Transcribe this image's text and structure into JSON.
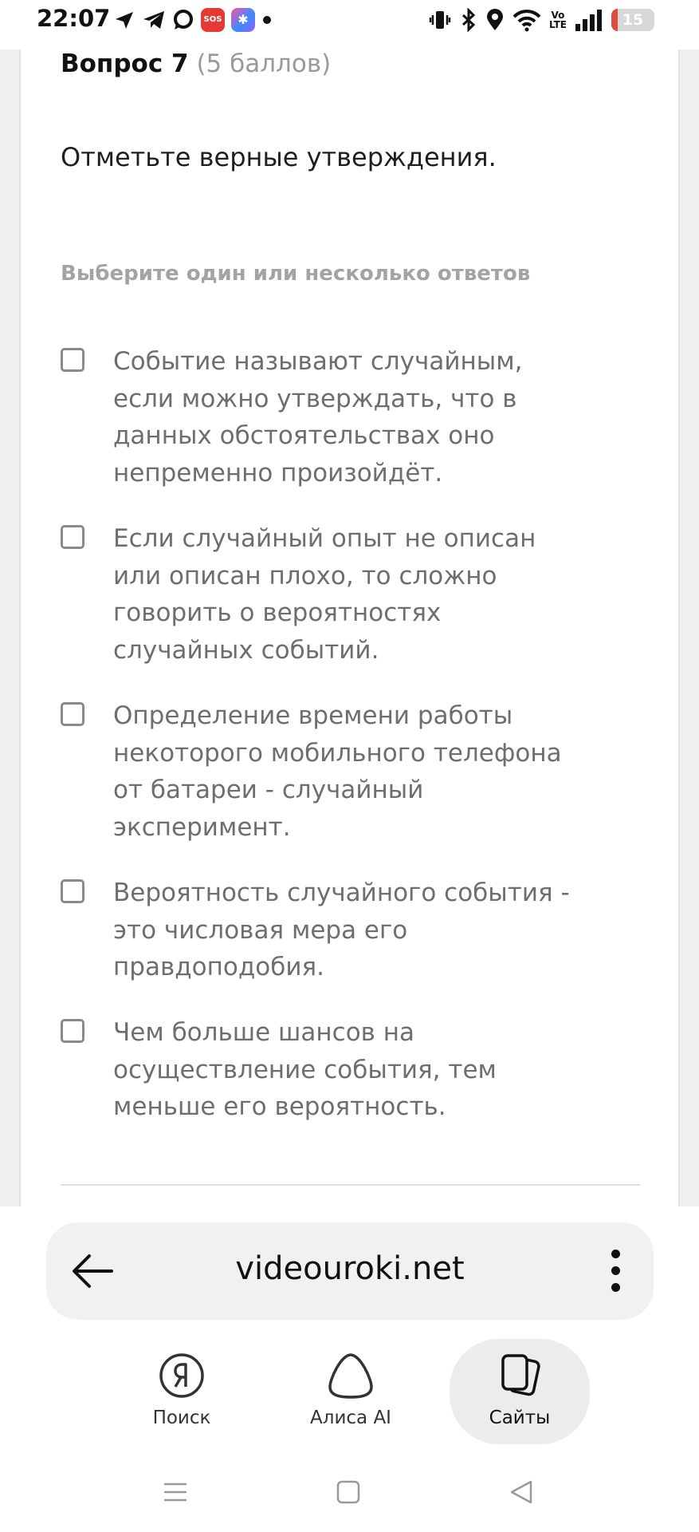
{
  "status_bar": {
    "time": "22:07",
    "left_icons": [
      "navigation-arrow-icon",
      "telegram-icon",
      "chat-bubble-icon",
      "sos-app-icon",
      "flower-app-icon",
      "more-dot-icon"
    ],
    "sos_label": "SOS",
    "right_icons": [
      "vibrate-icon",
      "bluetooth-icon",
      "location-icon",
      "wifi-icon",
      "volte-icon",
      "signal-icon",
      "battery-icon"
    ],
    "volte_label_top": "Vo",
    "volte_label_bottom": "LTE",
    "battery_level": "15",
    "battery_fraction": 0.15
  },
  "question": {
    "number_label": "Вопрос 7",
    "points_label": "(5 баллов)",
    "text": "Отметьте верные утверждения.",
    "instruction": "Выберите один или несколько ответов",
    "options": [
      {
        "text": "Событие называют случайным, если можно утверждать, что в данных обстоятельствах оно непременно произойдёт.",
        "checked": false
      },
      {
        "text": "Если случайный опыт не описан или описан плохо, то сложно говорить о вероятностях случайных событий.",
        "checked": false
      },
      {
        "text": "Определение времени работы некоторого мобильного телефона от батареи - случайный эксперимент.",
        "checked": false
      },
      {
        "text": "Вероятность случайного события - это числовая мера его правдоподобия.",
        "checked": false
      },
      {
        "text": "Чем больше шансов на осуществление события, тем меньше его вероятность.",
        "checked": false
      }
    ]
  },
  "browser": {
    "url": "videouroki.net",
    "back_icon": "back-arrow-icon",
    "menu_icon": "more-vertical-icon",
    "tabs": [
      {
        "label": "Поиск",
        "icon": "yandex-search-icon",
        "active": false
      },
      {
        "label": "Алиса AI",
        "icon": "alice-icon",
        "active": false
      },
      {
        "label": "Сайты",
        "icon": "sites-cards-icon",
        "active": true
      }
    ]
  },
  "system_nav": {
    "icons": [
      "menu-lines-icon",
      "home-square-icon",
      "back-triangle-icon"
    ]
  }
}
